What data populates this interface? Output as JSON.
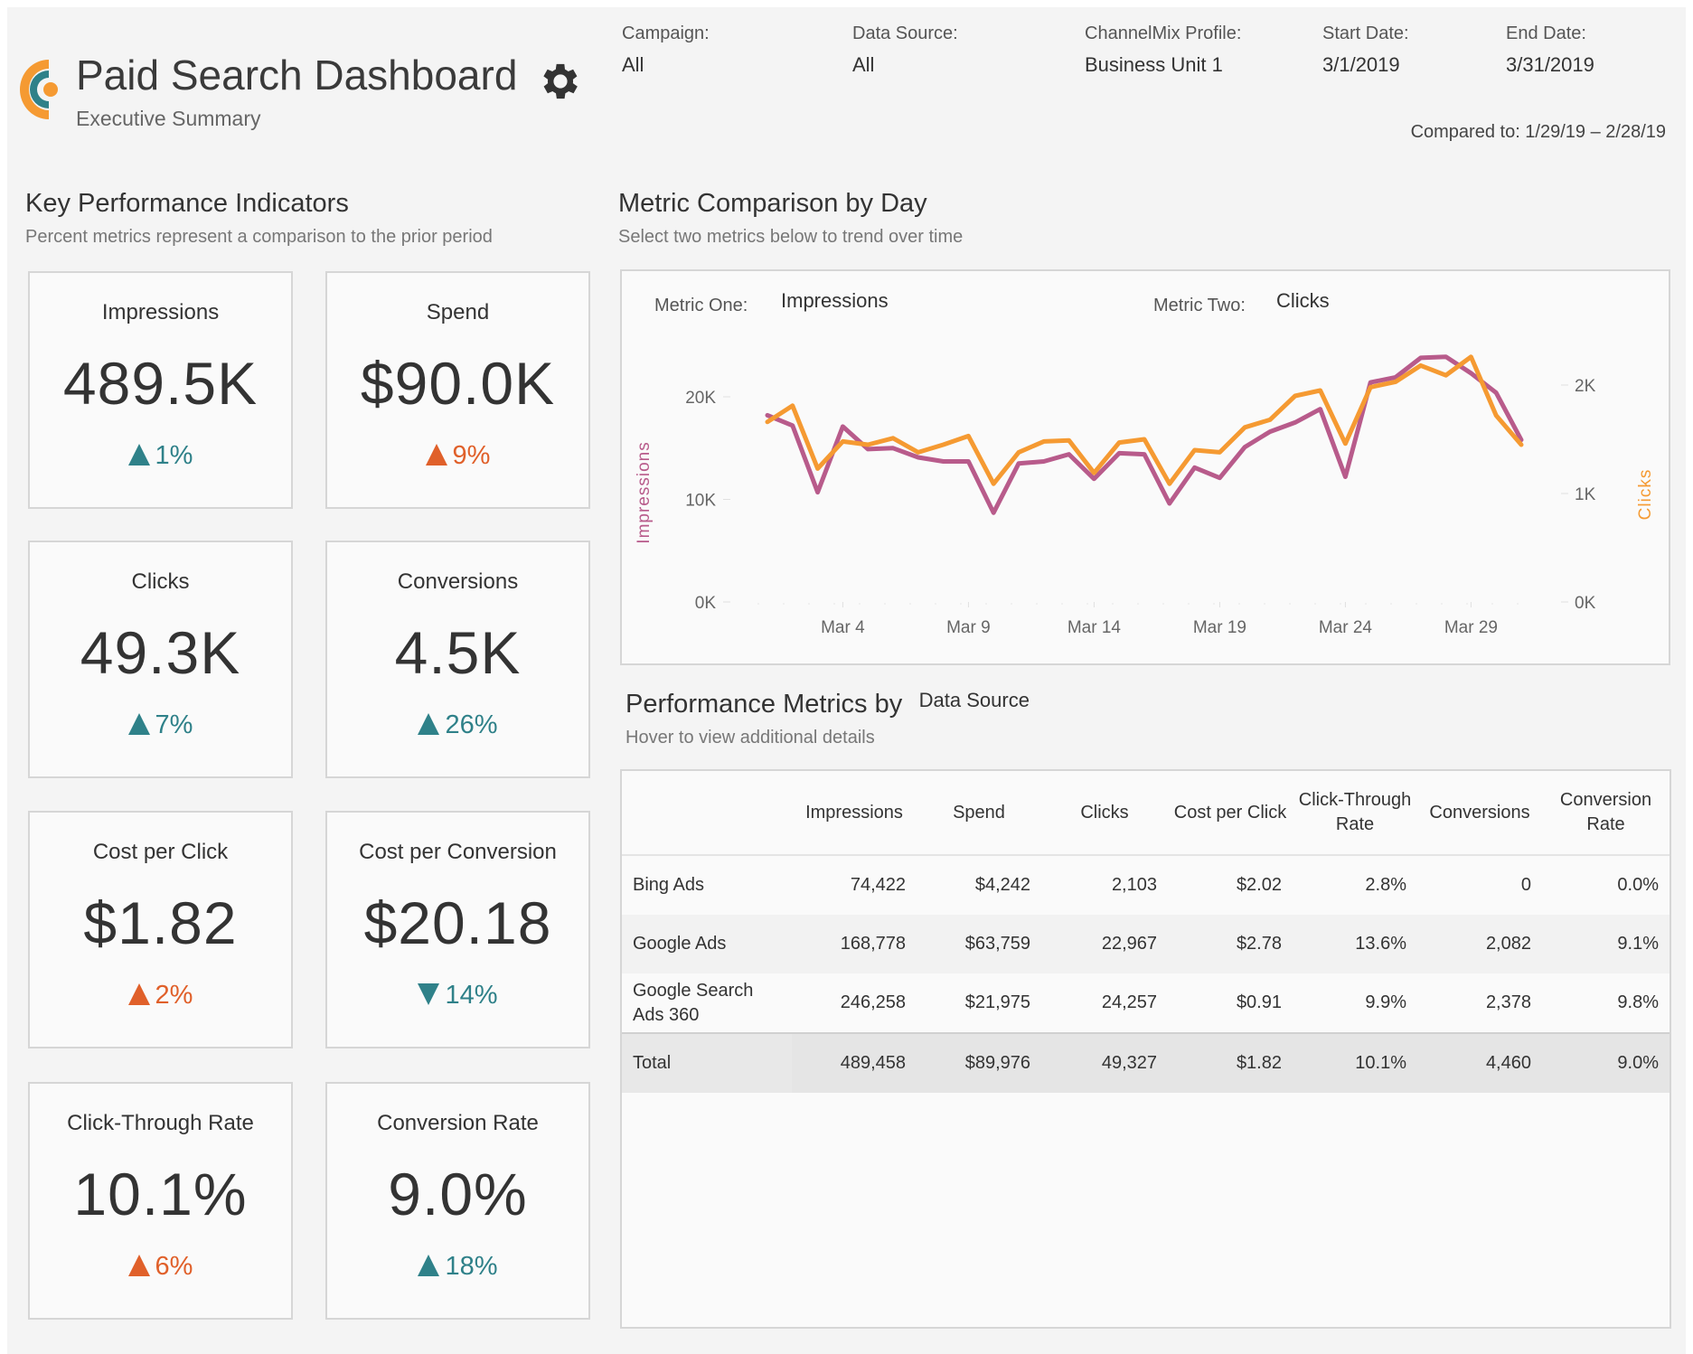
{
  "header": {
    "title": "Paid Search Dashboard",
    "subtitle": "Executive Summary",
    "settings_icon": "gear-icon",
    "logo": "channelmix-logo"
  },
  "filters": [
    {
      "label": "Campaign:",
      "value": "All"
    },
    {
      "label": "Data Source:",
      "value": "All"
    },
    {
      "label": "ChannelMix Profile:",
      "value": "Business Unit 1"
    },
    {
      "label": "Start Date:",
      "value": "3/1/2019"
    },
    {
      "label": "End Date:",
      "value": "3/31/2019"
    }
  ],
  "compared_to": "Compared to: 1/29/19 – 2/28/19",
  "colors": {
    "positive": "#2f8189",
    "negative": "#e0602a",
    "impressions_line": "#b85b8b",
    "clicks_line": "#f59a32",
    "logo_orange": "#f59a32",
    "logo_teal": "#2f8189"
  },
  "kpi": {
    "title": "Key Performance Indicators",
    "subtitle": "Percent metrics represent a comparison to the prior period",
    "cards": [
      {
        "label": "Impressions",
        "value": "489.5K",
        "change": "1%",
        "direction": "up",
        "sentiment": "positive"
      },
      {
        "label": "Spend",
        "value": "$90.0K",
        "change": "9%",
        "direction": "up",
        "sentiment": "negative"
      },
      {
        "label": "Clicks",
        "value": "49.3K",
        "change": "7%",
        "direction": "up",
        "sentiment": "positive"
      },
      {
        "label": "Conversions",
        "value": "4.5K",
        "change": "26%",
        "direction": "up",
        "sentiment": "positive"
      },
      {
        "label": "Cost per Click",
        "value": "$1.82",
        "change": "2%",
        "direction": "up",
        "sentiment": "negative"
      },
      {
        "label": "Cost per Conversion",
        "value": "$20.18",
        "change": "14%",
        "direction": "down",
        "sentiment": "positive"
      },
      {
        "label": "Click-Through Rate",
        "value": "10.1%",
        "change": "6%",
        "direction": "up",
        "sentiment": "negative"
      },
      {
        "label": "Conversion Rate",
        "value": "9.0%",
        "change": "18%",
        "direction": "up",
        "sentiment": "positive"
      }
    ]
  },
  "trend": {
    "title": "Metric Comparison by Day",
    "subtitle": "Select two metrics below to trend over time",
    "metric_one_label": "Metric One:",
    "metric_one_value": "Impressions",
    "metric_two_label": "Metric Two:",
    "metric_two_value": "Clicks"
  },
  "chart_data": {
    "type": "line",
    "title": "Metric Comparison by Day",
    "xlabel": "",
    "x": [
      "Mar 1",
      "Mar 2",
      "Mar 3",
      "Mar 4",
      "Mar 5",
      "Mar 6",
      "Mar 7",
      "Mar 8",
      "Mar 9",
      "Mar 10",
      "Mar 11",
      "Mar 12",
      "Mar 13",
      "Mar 14",
      "Mar 15",
      "Mar 16",
      "Mar 17",
      "Mar 18",
      "Mar 19",
      "Mar 20",
      "Mar 21",
      "Mar 22",
      "Mar 23",
      "Mar 24",
      "Mar 25",
      "Mar 26",
      "Mar 27",
      "Mar 28",
      "Mar 29",
      "Mar 30",
      "Mar 31"
    ],
    "x_ticks": [
      "Mar 4",
      "Mar 9",
      "Mar 14",
      "Mar 19",
      "Mar 24",
      "Mar 29"
    ],
    "x_tick_index": [
      3,
      8,
      13,
      18,
      23,
      28
    ],
    "series": [
      {
        "name": "Impressions",
        "axis": "left",
        "values": [
          18200,
          17200,
          10700,
          17100,
          14900,
          15000,
          14100,
          13700,
          13700,
          8700,
          13500,
          13700,
          14400,
          12000,
          14500,
          14400,
          9600,
          13100,
          12100,
          15100,
          16600,
          17500,
          18800,
          12200,
          21400,
          21900,
          23800,
          23900,
          22300,
          20400,
          15800
        ]
      },
      {
        "name": "Clicks",
        "axis": "right",
        "values": [
          1660,
          1810,
          1230,
          1480,
          1450,
          1510,
          1380,
          1450,
          1530,
          1090,
          1380,
          1480,
          1490,
          1190,
          1470,
          1500,
          1090,
          1400,
          1380,
          1610,
          1680,
          1900,
          1950,
          1460,
          1980,
          2030,
          2180,
          2090,
          2260,
          1720,
          1450
        ]
      }
    ],
    "y_left": {
      "label": "Impressions",
      "ticks": [
        "0K",
        "10K",
        "20K"
      ],
      "tick_values": [
        0,
        10000,
        20000
      ],
      "range": [
        0,
        26000
      ]
    },
    "y_right": {
      "label": "Clicks",
      "ticks": [
        "0K",
        "1K",
        "2K"
      ],
      "tick_values": [
        0,
        1000,
        2000
      ],
      "range": [
        0,
        2450
      ]
    },
    "grid": false,
    "legend": "none"
  },
  "table": {
    "title": "Performance Metrics by",
    "dimension": "Data Source",
    "subtitle": "Hover to view additional details",
    "columns": [
      "",
      "Impressions",
      "Spend",
      "Clicks",
      "Cost per Click",
      "Click-Through Rate",
      "Conversions",
      "Conversion Rate"
    ],
    "rows": [
      [
        "Bing Ads",
        "74,422",
        "$4,242",
        "2,103",
        "$2.02",
        "2.8%",
        "0",
        "0.0%"
      ],
      [
        "Google Ads",
        "168,778",
        "$63,759",
        "22,967",
        "$2.78",
        "13.6%",
        "2,082",
        "9.1%"
      ],
      [
        "Google Search Ads 360",
        "246,258",
        "$21,975",
        "24,257",
        "$0.91",
        "9.9%",
        "2,378",
        "9.8%"
      ]
    ],
    "total": [
      "Total",
      "489,458",
      "$89,976",
      "49,327",
      "$1.82",
      "10.1%",
      "4,460",
      "9.0%"
    ]
  }
}
